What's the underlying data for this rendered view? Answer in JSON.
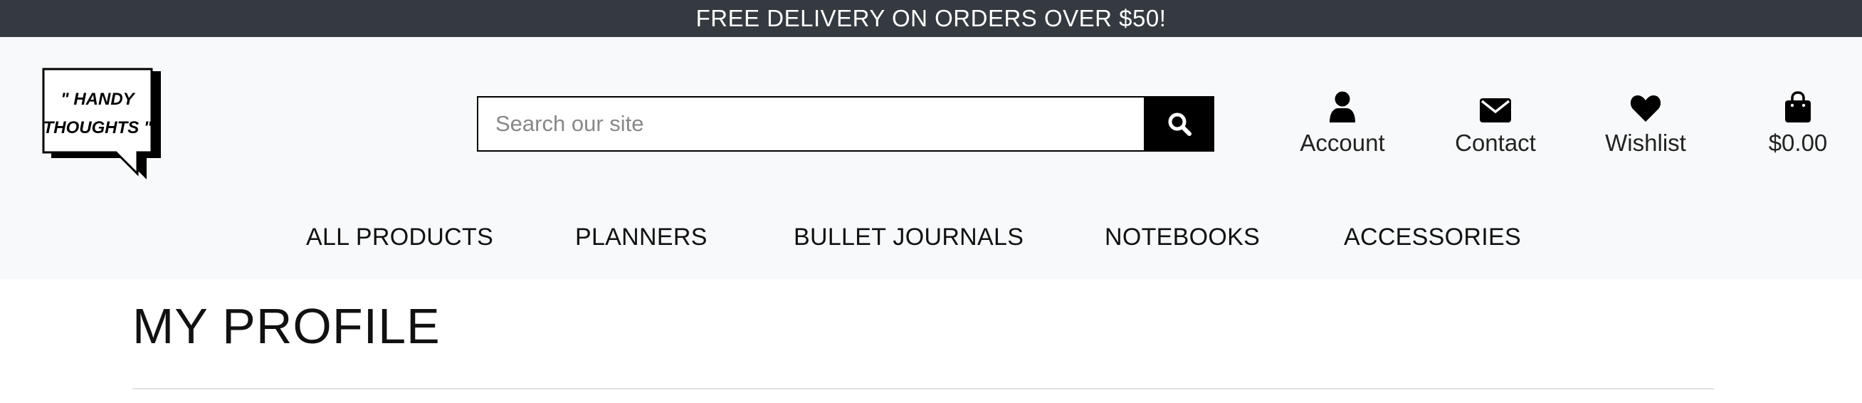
{
  "banner": {
    "text": "FREE DELIVERY ON ORDERS OVER $50!"
  },
  "logo": {
    "line1": "\" HANDY",
    "line2": "THOUGHTS \""
  },
  "search": {
    "placeholder": "Search our site"
  },
  "header_links": {
    "account": "Account",
    "contact": "Contact",
    "wishlist": "Wishlist",
    "cart": "$0.00"
  },
  "nav": {
    "items": [
      "ALL PRODUCTS",
      "PLANNERS",
      "BULLET JOURNALS",
      "NOTEBOOKS",
      "ACCESSORIES"
    ]
  },
  "page": {
    "title": "MY PROFILE"
  },
  "colors": {
    "banner": "#343a40",
    "header_bg": "#f8f9fa",
    "accent": "#000000"
  },
  "icons": [
    "search-icon",
    "user-icon",
    "envelope-icon",
    "heart-icon",
    "shopping-bag-icon"
  ]
}
